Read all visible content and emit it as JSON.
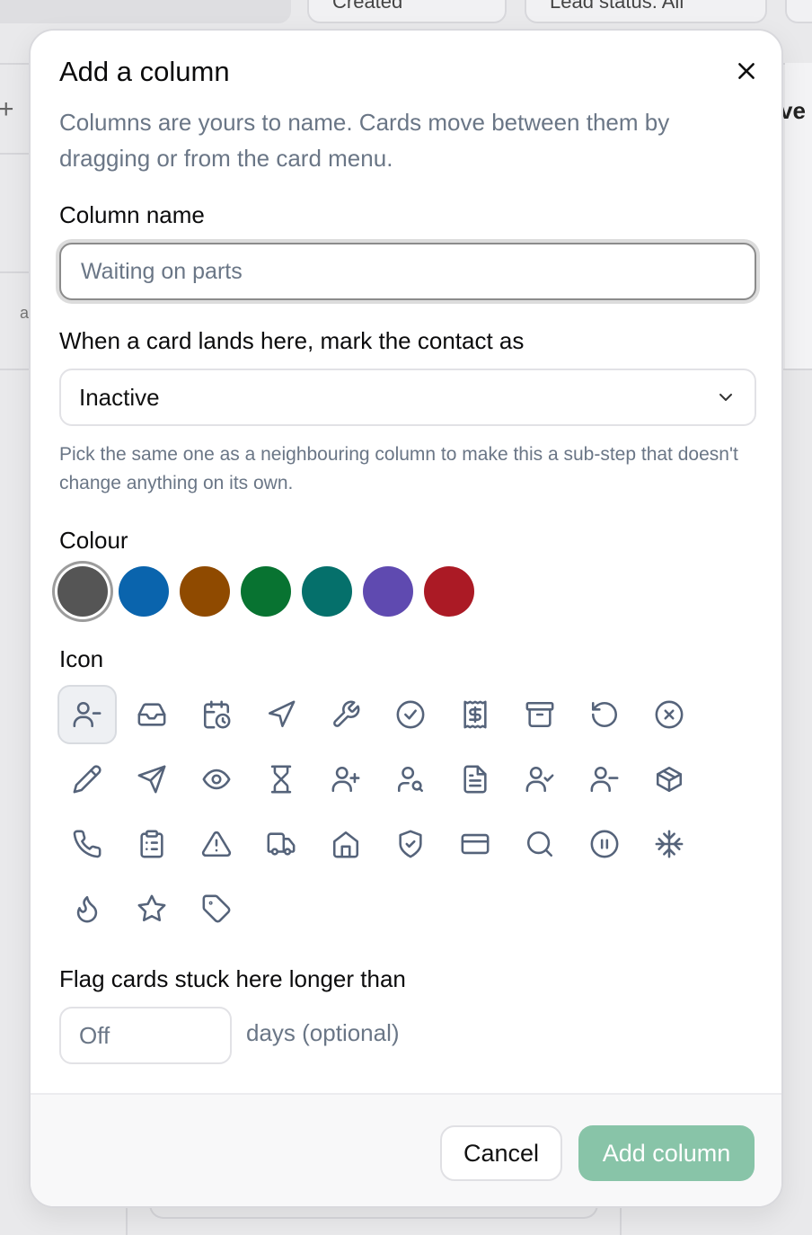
{
  "background": {
    "filter_pills": [
      "",
      "Created",
      "Lead status: All",
      ""
    ],
    "add_symbol": "+",
    "right_fragment": "ve",
    "left_fragment": "a"
  },
  "modal": {
    "title": "Add a column",
    "description": "Columns are yours to name. Cards move between them by dragging or from the card menu.",
    "column_name": {
      "label": "Column name",
      "value": "",
      "placeholder": "Waiting on parts"
    },
    "status": {
      "label": "When a card lands here, mark the contact as",
      "selected": "Inactive",
      "hint": "Pick the same one as a neighbouring column to make this a sub-step that doesn't change anything on its own."
    },
    "colour": {
      "label": "Colour",
      "options": [
        "#555555",
        "#0a64ad",
        "#8f4a00",
        "#087331",
        "#05706b",
        "#5f4ab0",
        "#ab1a25"
      ],
      "selected_index": 0
    },
    "icon": {
      "label": "Icon",
      "selected_index": 0,
      "options": [
        "user-minus-icon",
        "inbox-icon",
        "calendar-clock-icon",
        "navigation-icon",
        "wrench-icon",
        "circle-check-icon",
        "receipt-dollar-icon",
        "archive-icon",
        "rotate-ccw-icon",
        "circle-x-icon",
        "pencil-icon",
        "send-icon",
        "eye-icon",
        "hourglass-icon",
        "user-plus-icon",
        "user-search-icon",
        "file-text-icon",
        "user-check-icon",
        "user-minus-alt-icon",
        "package-icon",
        "phone-icon",
        "clipboard-list-icon",
        "alert-triangle-icon",
        "truck-icon",
        "home-icon",
        "shield-check-icon",
        "credit-card-icon",
        "search-icon",
        "circle-pause-icon",
        "snowflake-icon",
        "flame-icon",
        "star-icon",
        "tag-icon"
      ]
    },
    "stuck": {
      "label": "Flag cards stuck here longer than",
      "value": "",
      "placeholder": "Off",
      "suffix": "days (optional)"
    },
    "footer": {
      "cancel_label": "Cancel",
      "add_label": "Add column"
    }
  }
}
